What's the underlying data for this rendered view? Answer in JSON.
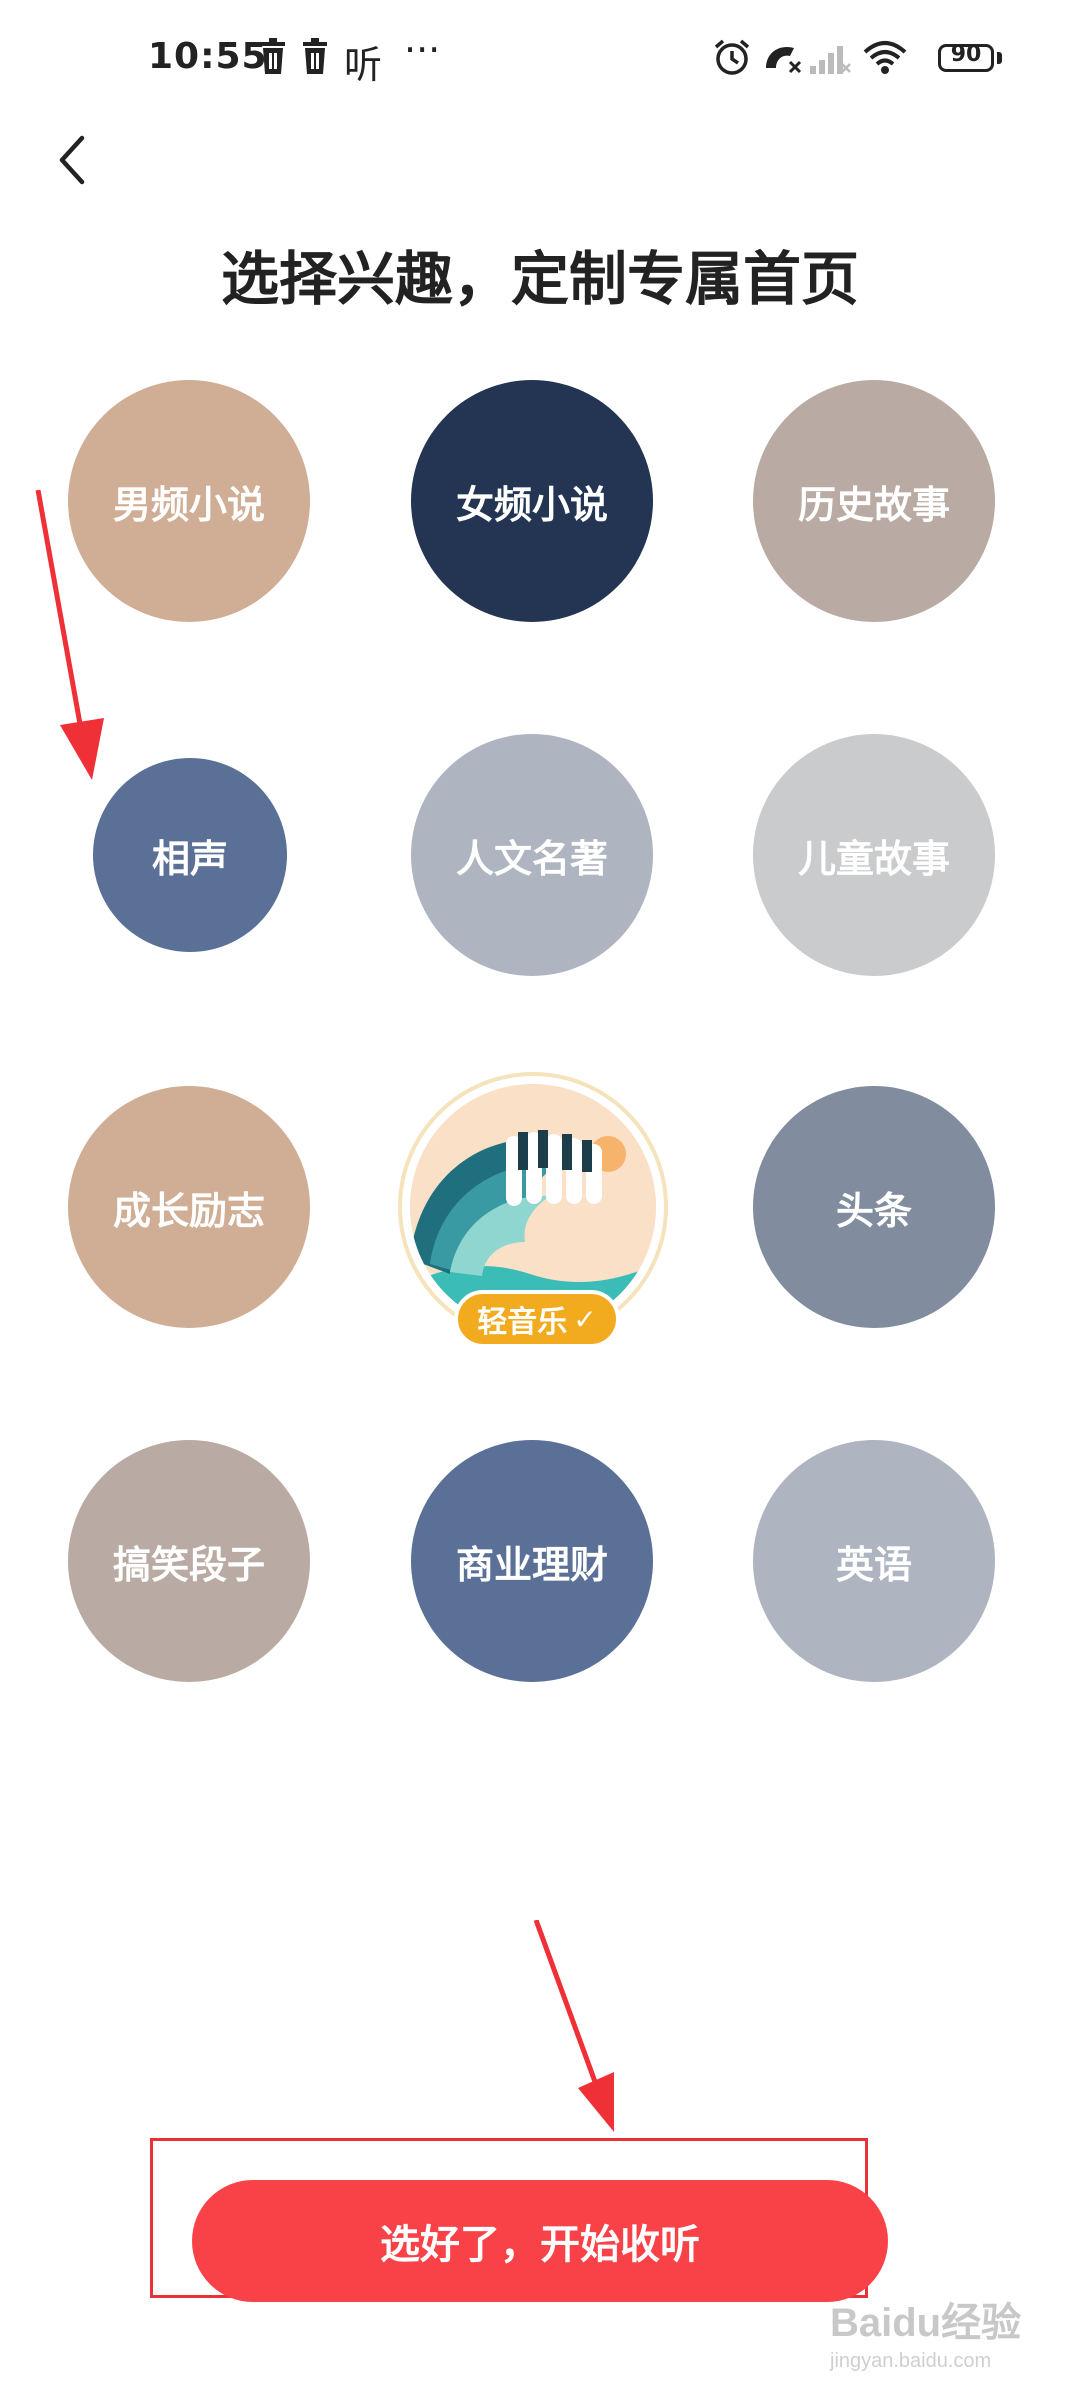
{
  "status_bar": {
    "time": "10:55",
    "listen_glyph": "听",
    "more_glyph": "···",
    "battery": "90",
    "icons": [
      "trash-icon",
      "trash-icon",
      "alarm-icon",
      "call-muted-icon",
      "signal-icon",
      "wifi-icon",
      "battery-icon"
    ]
  },
  "header": {
    "title": "选择兴趣，定制专属首页",
    "back_icon": "chevron-left-icon"
  },
  "topics": [
    {
      "label": "男频小说",
      "color": "#d0ae95"
    },
    {
      "label": "女频小说",
      "color": "#233552",
      "selected": true
    },
    {
      "label": "历史故事",
      "color": "#b9aba3"
    },
    {
      "label": "相声",
      "color": "#5a7096",
      "selected": true
    },
    {
      "label": "人文名著",
      "color": "#aeb5c0"
    },
    {
      "label": "儿童故事",
      "color": "#cacbcc"
    },
    {
      "label": "成长励志",
      "color": "#d0ae95"
    },
    {
      "label": "轻音乐",
      "featured": true
    },
    {
      "label": "头条",
      "color": "#818d9f"
    },
    {
      "label": "搞笑段子",
      "color": "#b9aba3"
    },
    {
      "label": "商业理财",
      "color": "#5a7096"
    },
    {
      "label": "英语",
      "color": "#aeb5c0"
    }
  ],
  "footer": {
    "start_label": "选好了，开始收听",
    "start_color": "#f94148"
  },
  "watermark": {
    "brand": "Baidu经验",
    "url": "jingyan.baidu.com"
  }
}
